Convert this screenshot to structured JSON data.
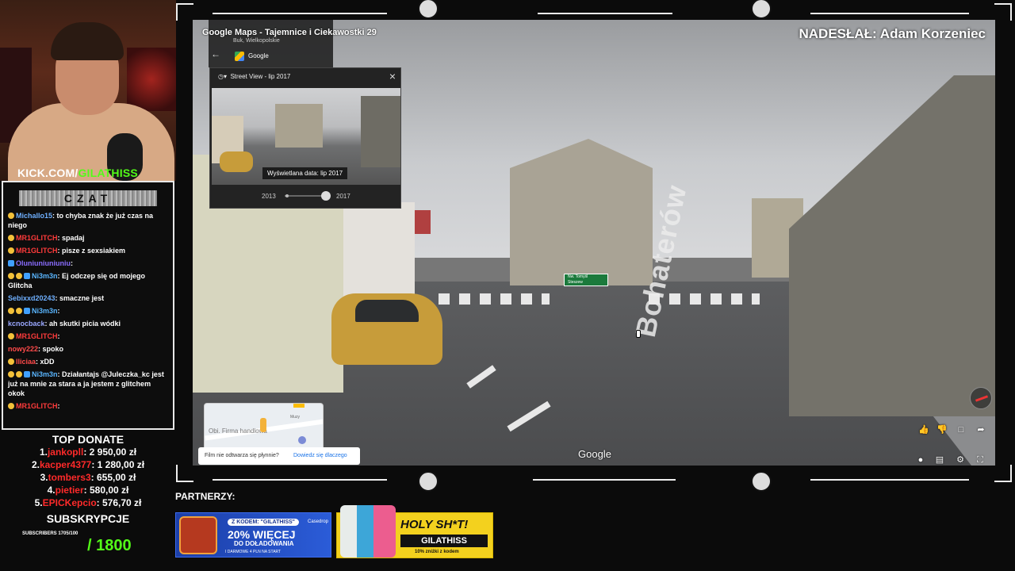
{
  "stream": {
    "kick_prefix": "KICK.COM/",
    "kick_handle": "GILATHISS",
    "chat_title": "CZAT"
  },
  "chat": [
    {
      "user": "Michallo15",
      "color": "#6fb0ff",
      "text": ": to chyba znak że już czas na niego",
      "badges": [
        "coin"
      ]
    },
    {
      "user": "MR1GLITCH",
      "color": "#ff3b3b",
      "text": ": spadaj",
      "badges": [
        "coin"
      ]
    },
    {
      "user": "MR1GLITCH",
      "color": "#ff3b3b",
      "text": ": pisze z sexsiakiem",
      "badges": [
        "coin"
      ]
    },
    {
      "user": "Oluniuniuniuniu",
      "color": "#8a6dff",
      "text": ":",
      "badges": [
        "sword"
      ]
    },
    {
      "user": "Ni3m3n",
      "color": "#5ab6ff",
      "text": ": Ej odczep się od mojego Glitcha",
      "badges": [
        "crown",
        "coin",
        "gem"
      ]
    },
    {
      "user": "Sebixxd20243",
      "color": "#6fb0ff",
      "text": ": smaczne jest",
      "badges": []
    },
    {
      "user": "Ni3m3n",
      "color": "#5ab6ff",
      "text": ":",
      "badges": [
        "crown",
        "coin",
        "gem"
      ]
    },
    {
      "user": "kcnocback",
      "color": "#9aa8ff",
      "text": ": ah skutki picia wódki",
      "badges": []
    },
    {
      "user": "MR1GLITCH",
      "color": "#ff3b3b",
      "text": ":",
      "badges": [
        "coin"
      ]
    },
    {
      "user": "nowy222",
      "color": "#ff4a4a",
      "text": ": spoko",
      "badges": []
    },
    {
      "user": "lliciaa",
      "color": "#ff4a4a",
      "text": ": xDD",
      "badges": [
        "coin"
      ]
    },
    {
      "user": "Ni3m3n",
      "color": "#5ab6ff",
      "text": ": Działantajs @Juleczka_kc jest już na mnie za stara a ja jestem z glitchem okok",
      "badges": [
        "crown",
        "coin",
        "gem"
      ]
    },
    {
      "user": "MR1GLITCH",
      "color": "#ff3b3b",
      "text": ":",
      "badges": [
        "coin"
      ]
    }
  ],
  "donate": {
    "title": "TOP DONATE",
    "rows": [
      {
        "rank": "1.",
        "name": "jankopll",
        "amount": ": 2 950,00 zł"
      },
      {
        "rank": "2.",
        "name": "kacper4377",
        "amount": ": 1 280,00 zł"
      },
      {
        "rank": "3.",
        "name": "tombers3",
        "amount": ": 655,00 zł"
      },
      {
        "rank": "4.",
        "name": "pietier",
        "amount": ": 580,00 zł"
      },
      {
        "rank": "5.",
        "name": "EPICKepcio",
        "amount": ": 576,70 zł"
      }
    ],
    "subs_title": "SUBSKRYPCJE",
    "subs_small": "SUBSCRIBERS 1705/100",
    "subs_goal": "/ 1800"
  },
  "streetview": {
    "title": "Google Maps - Tajemnice i Ciekawostki 29",
    "sender": "NADESŁAŁ: Adam Korzeniec",
    "location_sub": "Buk, Wielkopolskie",
    "google_label": "Google",
    "street_name": "Bohaterów",
    "sign_text_1": "Nw. Tomyśl",
    "sign_text_2": "Steszew",
    "watermark": "Google"
  },
  "time_machine": {
    "header": "Street View - lip 2017",
    "thumb_label": "Wyświetlana data: lip 2017",
    "year_from": "2013",
    "year_to": "2017"
  },
  "minimap": {
    "label": "Obi. Firma handlowa",
    "label2": "Muzy"
  },
  "playback_tip": {
    "text": "Film nie odtwarza się płynnie?",
    "link": "Dowiedz się dlaczego"
  },
  "partners": {
    "title": "PARTNERZY:",
    "ad1": {
      "code": "Z KODEM: \"GILATHISS\"",
      "big": "20% WIĘCEJ",
      "mid": "DO DOŁADOWANIA",
      "small": "I DARMOWE 4 PLN NA START",
      "brand": "Casedrop"
    },
    "ad2": {
      "headline": "HOLY SH*T!",
      "code": "GILATHISS",
      "disc": "10% zniżki z kodem"
    }
  },
  "icons": [
    "back-arrow-icon",
    "history-icon",
    "close-icon",
    "thumbs-up-icon",
    "thumbs-down-icon",
    "caption-icon",
    "share-icon",
    "settings-icon",
    "fullscreen-icon",
    "compass-icon"
  ]
}
